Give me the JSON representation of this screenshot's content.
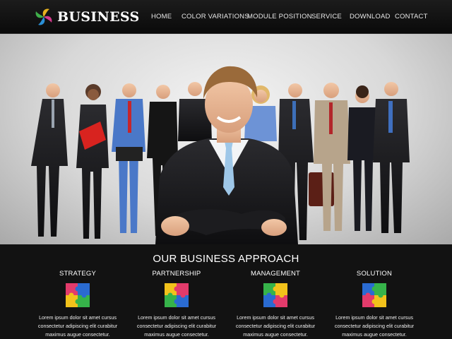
{
  "brand": {
    "name": "BUSINESS",
    "logo_icon": "swirl-logo-icon"
  },
  "nav": {
    "items": [
      {
        "label": "HOME"
      },
      {
        "label": "COLOR VARIATIONS"
      },
      {
        "label": "MODULE POSITION"
      },
      {
        "label": "SERVICE"
      },
      {
        "label": "DOWNLOAD"
      },
      {
        "label": "CONTACT"
      }
    ]
  },
  "hero": {
    "image": "business-team-photo"
  },
  "approach": {
    "title": "OUR BUSINESS APPROACH",
    "columns": [
      {
        "title": "STRATEGY",
        "icon": "puzzle-icon",
        "text": [
          "Lorem ipsum dolor sit amet cursus",
          "consectetur adipiscing elit curabitur",
          "maximus augue consectetur."
        ]
      },
      {
        "title": "PARTNERSHIP",
        "icon": "puzzle-icon",
        "text": [
          "Lorem ipsum dolor sit amet cursus",
          "consectetur adipiscing elit curabitur",
          "maximus augue consectetur."
        ]
      },
      {
        "title": "MANAGEMENT",
        "icon": "puzzle-icon",
        "text": [
          "Lorem ipsum dolor sit amet cursus",
          "consectetur adipiscing elit curabitur",
          "maximus augue consectetur."
        ]
      },
      {
        "title": "SOLUTION",
        "icon": "puzzle-icon",
        "text": [
          "Lorem ipsum dolor sit amet cursus",
          "consectetur adipiscing elit curabitur",
          "maximus augue consectetur."
        ]
      }
    ]
  },
  "colors": {
    "header_bg": "#111111",
    "section_bg": "#121212",
    "text": "#ffffff"
  }
}
